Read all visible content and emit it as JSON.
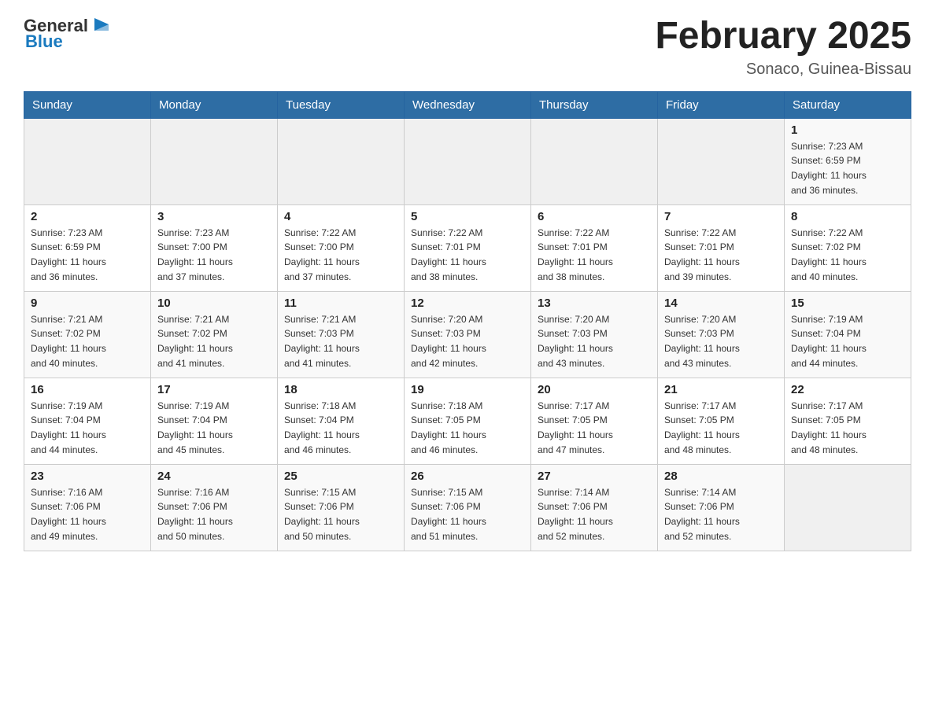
{
  "header": {
    "logo_general": "General",
    "logo_blue": "Blue",
    "month_title": "February 2025",
    "location": "Sonaco, Guinea-Bissau"
  },
  "weekdays": [
    "Sunday",
    "Monday",
    "Tuesday",
    "Wednesday",
    "Thursday",
    "Friday",
    "Saturday"
  ],
  "weeks": [
    [
      {
        "day": "",
        "info": ""
      },
      {
        "day": "",
        "info": ""
      },
      {
        "day": "",
        "info": ""
      },
      {
        "day": "",
        "info": ""
      },
      {
        "day": "",
        "info": ""
      },
      {
        "day": "",
        "info": ""
      },
      {
        "day": "1",
        "info": "Sunrise: 7:23 AM\nSunset: 6:59 PM\nDaylight: 11 hours\nand 36 minutes."
      }
    ],
    [
      {
        "day": "2",
        "info": "Sunrise: 7:23 AM\nSunset: 6:59 PM\nDaylight: 11 hours\nand 36 minutes."
      },
      {
        "day": "3",
        "info": "Sunrise: 7:23 AM\nSunset: 7:00 PM\nDaylight: 11 hours\nand 37 minutes."
      },
      {
        "day": "4",
        "info": "Sunrise: 7:22 AM\nSunset: 7:00 PM\nDaylight: 11 hours\nand 37 minutes."
      },
      {
        "day": "5",
        "info": "Sunrise: 7:22 AM\nSunset: 7:01 PM\nDaylight: 11 hours\nand 38 minutes."
      },
      {
        "day": "6",
        "info": "Sunrise: 7:22 AM\nSunset: 7:01 PM\nDaylight: 11 hours\nand 38 minutes."
      },
      {
        "day": "7",
        "info": "Sunrise: 7:22 AM\nSunset: 7:01 PM\nDaylight: 11 hours\nand 39 minutes."
      },
      {
        "day": "8",
        "info": "Sunrise: 7:22 AM\nSunset: 7:02 PM\nDaylight: 11 hours\nand 40 minutes."
      }
    ],
    [
      {
        "day": "9",
        "info": "Sunrise: 7:21 AM\nSunset: 7:02 PM\nDaylight: 11 hours\nand 40 minutes."
      },
      {
        "day": "10",
        "info": "Sunrise: 7:21 AM\nSunset: 7:02 PM\nDaylight: 11 hours\nand 41 minutes."
      },
      {
        "day": "11",
        "info": "Sunrise: 7:21 AM\nSunset: 7:03 PM\nDaylight: 11 hours\nand 41 minutes."
      },
      {
        "day": "12",
        "info": "Sunrise: 7:20 AM\nSunset: 7:03 PM\nDaylight: 11 hours\nand 42 minutes."
      },
      {
        "day": "13",
        "info": "Sunrise: 7:20 AM\nSunset: 7:03 PM\nDaylight: 11 hours\nand 43 minutes."
      },
      {
        "day": "14",
        "info": "Sunrise: 7:20 AM\nSunset: 7:03 PM\nDaylight: 11 hours\nand 43 minutes."
      },
      {
        "day": "15",
        "info": "Sunrise: 7:19 AM\nSunset: 7:04 PM\nDaylight: 11 hours\nand 44 minutes."
      }
    ],
    [
      {
        "day": "16",
        "info": "Sunrise: 7:19 AM\nSunset: 7:04 PM\nDaylight: 11 hours\nand 44 minutes."
      },
      {
        "day": "17",
        "info": "Sunrise: 7:19 AM\nSunset: 7:04 PM\nDaylight: 11 hours\nand 45 minutes."
      },
      {
        "day": "18",
        "info": "Sunrise: 7:18 AM\nSunset: 7:04 PM\nDaylight: 11 hours\nand 46 minutes."
      },
      {
        "day": "19",
        "info": "Sunrise: 7:18 AM\nSunset: 7:05 PM\nDaylight: 11 hours\nand 46 minutes."
      },
      {
        "day": "20",
        "info": "Sunrise: 7:17 AM\nSunset: 7:05 PM\nDaylight: 11 hours\nand 47 minutes."
      },
      {
        "day": "21",
        "info": "Sunrise: 7:17 AM\nSunset: 7:05 PM\nDaylight: 11 hours\nand 48 minutes."
      },
      {
        "day": "22",
        "info": "Sunrise: 7:17 AM\nSunset: 7:05 PM\nDaylight: 11 hours\nand 48 minutes."
      }
    ],
    [
      {
        "day": "23",
        "info": "Sunrise: 7:16 AM\nSunset: 7:06 PM\nDaylight: 11 hours\nand 49 minutes."
      },
      {
        "day": "24",
        "info": "Sunrise: 7:16 AM\nSunset: 7:06 PM\nDaylight: 11 hours\nand 50 minutes."
      },
      {
        "day": "25",
        "info": "Sunrise: 7:15 AM\nSunset: 7:06 PM\nDaylight: 11 hours\nand 50 minutes."
      },
      {
        "day": "26",
        "info": "Sunrise: 7:15 AM\nSunset: 7:06 PM\nDaylight: 11 hours\nand 51 minutes."
      },
      {
        "day": "27",
        "info": "Sunrise: 7:14 AM\nSunset: 7:06 PM\nDaylight: 11 hours\nand 52 minutes."
      },
      {
        "day": "28",
        "info": "Sunrise: 7:14 AM\nSunset: 7:06 PM\nDaylight: 11 hours\nand 52 minutes."
      },
      {
        "day": "",
        "info": ""
      }
    ]
  ]
}
